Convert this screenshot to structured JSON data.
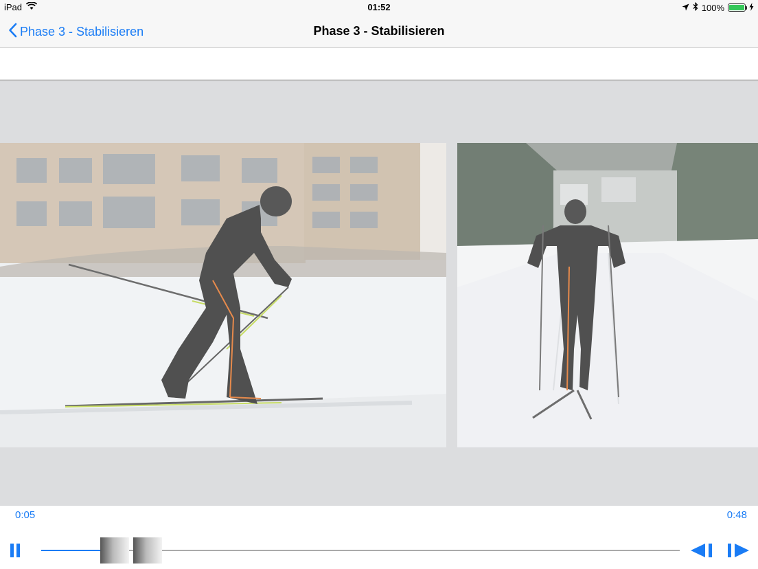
{
  "status_bar": {
    "device": "iPad",
    "time": "01:52",
    "battery_percent": "100%",
    "battery_level": 1.0,
    "icons": [
      "wifi-icon",
      "location-icon",
      "bluetooth-icon",
      "battery-icon",
      "charging-icon"
    ]
  },
  "nav": {
    "back_label": "Phase 3 - Stabilisieren",
    "title": "Phase 3 - Stabilisieren"
  },
  "player": {
    "current_time": "0:05",
    "total_time": "0:48",
    "progress": 0.104,
    "accent_color": "#1a7cf5",
    "frames": [
      "side-view-skier",
      "front-view-skier"
    ]
  }
}
